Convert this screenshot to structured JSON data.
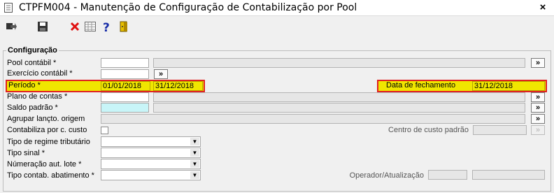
{
  "window": {
    "title": "CTPFM004 - Manutenção de Configuração de Contabilização por Pool",
    "close_glyph": "×"
  },
  "group": {
    "title": "Configuração"
  },
  "fields": {
    "pool_contabil": {
      "label": "Pool contábil *"
    },
    "exercicio": {
      "label": "Exercício contábil *"
    },
    "periodo": {
      "label": "Período *",
      "start": "01/01/2018",
      "end": "31/12/2018"
    },
    "data_fechamento": {
      "label": "Data de fechamento",
      "value": "31/12/2018"
    },
    "plano_contas": {
      "label": "Plano de contas *"
    },
    "saldo_padrao": {
      "label": "Saldo padrão *"
    },
    "agrupar": {
      "label": "Agrupar lançto. origem"
    },
    "contabiliza": {
      "label": "Contabiliza por c. custo"
    },
    "centro_custo": {
      "label": "Centro de custo padrão"
    },
    "regime": {
      "label": "Tipo de regime tributário"
    },
    "sinal": {
      "label": "Tipo sinal *"
    },
    "numeracao": {
      "label": "Númeração aut. lote *"
    },
    "abatimento": {
      "label": "Tipo contab. abatimento *"
    },
    "operador": {
      "label": "Operador/Atualização"
    }
  },
  "buttons": {
    "lookup_glyph": "»",
    "dropdown_glyph": "▼"
  },
  "icons": [
    "exit-icon",
    "save-icon",
    "delete-icon",
    "grid-icon",
    "help-icon",
    "door-icon"
  ],
  "colors": {
    "highlight_fill": "#f0e600",
    "highlight_border": "#e02020",
    "required_fill": "#c8f5f8"
  }
}
